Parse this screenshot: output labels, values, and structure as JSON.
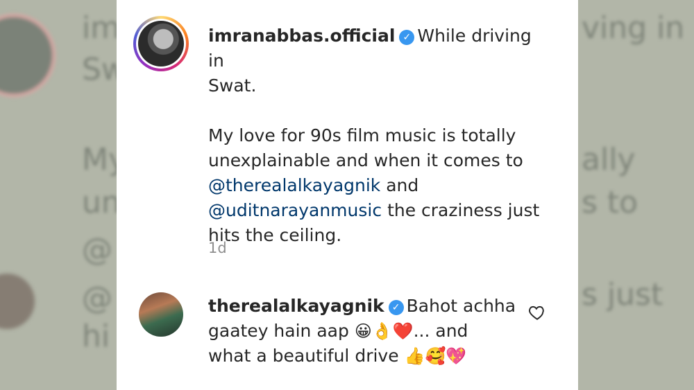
{
  "post": {
    "username": "imranabbas.official",
    "caption_line1": "While driving in",
    "caption_line2": "Swat.",
    "caption_p2_a": "My love for 90s film music is totally",
    "caption_p2_b": "unexplainable and when it comes to",
    "mention1": "@therealalkayagnik",
    "and_word": "and",
    "mention2": "@uditnarayanmusic",
    "caption_p2_c": "the craziness just",
    "caption_p2_d": "hits the ceiling.",
    "time": "1d"
  },
  "comment": {
    "username": "therealalkayagnik",
    "text1": "Bahot achha",
    "text2": "gaatey hain aap",
    "emojis1": "😀👌❤️",
    "text3": "... and",
    "text4": "what a beautiful drive",
    "emojis2": "👍🥰💖"
  },
  "background": {
    "ghost1": "im",
    "ghost2": "Sw",
    "ghost3": "My",
    "ghost4": "un",
    "ghost5": "@",
    "ghost6": "hi",
    "ghost_r1": "ving in",
    "ghost_r2": "ally",
    "ghost_r3": "s to",
    "ghost_r4": "s just"
  },
  "icons": {
    "heart": "heart-outline-icon",
    "verified": "verified-badge-icon"
  }
}
